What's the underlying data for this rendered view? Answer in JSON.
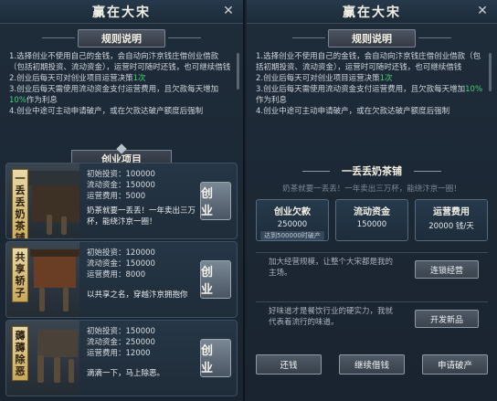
{
  "left": {
    "title": "赢在大宋",
    "close_icon": "close-icon",
    "rules_header": "规则说明",
    "rules": [
      {
        "pre": "1.选择创业不使用自己的金钱，会自动向汴京钱庄借创业借款（包括初期投资、流动资金），运营时可随时还钱，也可继续借钱",
        "hl": "",
        "post": ""
      },
      {
        "pre": "2.创业后每天可对创业项目运营决策",
        "hl": "1次",
        "post": ""
      },
      {
        "pre": "3.创业后每天需使用流动资金支付运营费用，且欠款每天增加",
        "hl": "10%",
        "post": "作为利息"
      },
      {
        "pre": "4.创业中途可主动申请破产，或在欠款达破产额度后强制",
        "hl": "",
        "post": ""
      }
    ],
    "projects_header": "创业项目",
    "projects": [
      {
        "tag": "一丢丢奶茶铺",
        "invest": "初始投资：100000",
        "fund": "流动资金：150000",
        "cost": "运营费用：5000",
        "desc": "奶茶就要一丢丢！一年卖出三万杯，能绕汴京一圈！",
        "button": "创业"
      },
      {
        "tag": "共享轿子",
        "invest": "初始投资：120000",
        "fund": "流动资金：150000",
        "cost": "运营费用：8000",
        "desc": "以共享之名，穿越汴京拥抱你",
        "button": "创业"
      },
      {
        "tag": "薅薅除恶",
        "invest": "初始投资：150000",
        "fund": "流动资金：250000",
        "cost": "运营费用：12000",
        "desc": "滴滴一下，马上除恶。",
        "button": "创业"
      }
    ]
  },
  "right": {
    "title": "赢在大宋",
    "close_icon": "close-icon",
    "rules_header": "规则说明",
    "shop_name": "一丢丢奶茶铺",
    "slogan": "奶茶就要一丢丢！一年卖出三万杯，能绕汴京一圈！",
    "stats": [
      {
        "label": "创业欠款",
        "value": "250000",
        "sub": "达到500000时破产"
      },
      {
        "label": "流动资金",
        "value": "150000",
        "sub": ""
      },
      {
        "label": "运营费用",
        "value": "20000 钱/天",
        "sub": ""
      }
    ],
    "actions": [
      {
        "text": "加大经营规模，让整个大宋都是我的主场。",
        "button": "连锁经营"
      },
      {
        "text": "好味道才是餐饮行业的硬实力，我就代表着流行的味道。",
        "button": "开发新品"
      }
    ],
    "bottom_buttons": [
      "还钱",
      "继续借钱",
      "申请破产"
    ]
  }
}
